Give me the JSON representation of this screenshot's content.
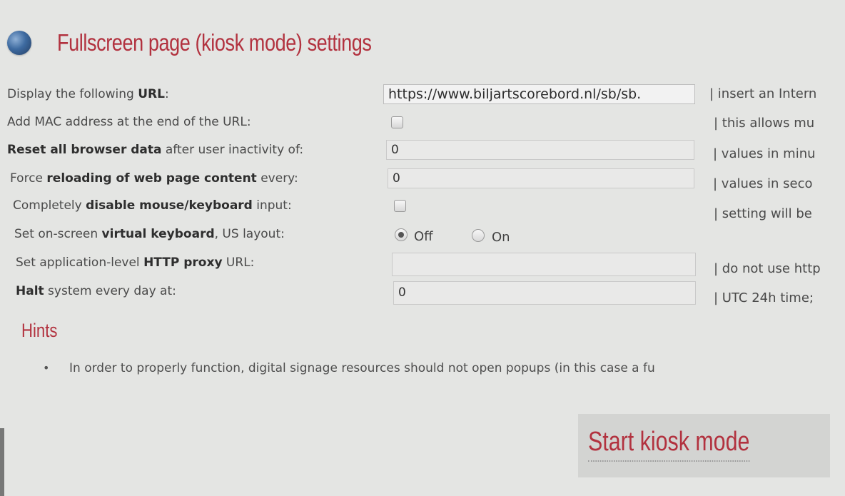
{
  "header": {
    "title": "Fullscreen page (kiosk mode) settings",
    "icon": "globe-icon"
  },
  "settings": {
    "url": {
      "label_pre": "Display the following ",
      "label_bold": "URL",
      "label_post": ":",
      "value": "https://www.biljartscorebord.nl/sb/sb.",
      "hint": "|  insert an Intern"
    },
    "mac": {
      "label": "Add MAC address at the end of the URL:",
      "checked": false,
      "hint": "|  this allows mu"
    },
    "reset": {
      "label_bold": "Reset all browser data",
      "label_post": " after user inactivity of:",
      "value": "0",
      "hint": "|  values in minu"
    },
    "reload": {
      "label_pre": "Force ",
      "label_bold": "reloading of web page content",
      "label_post": " every:",
      "value": "0",
      "hint": "|  values in seco"
    },
    "disable_input": {
      "label_pre": "Completely ",
      "label_bold": "disable mouse/keyboard",
      "label_post": " input:",
      "checked": false,
      "hint": "|  setting will be"
    },
    "virtual_keyboard": {
      "label_pre": "Set on-screen ",
      "label_bold": "virtual keyboard",
      "label_post": ", US layout:",
      "off_label": "Off",
      "on_label": "On",
      "selected": "Off"
    },
    "proxy": {
      "label_pre": "Set application-level ",
      "label_bold": "HTTP proxy",
      "label_post": " URL:",
      "value": "",
      "hint": "|  do not use http"
    },
    "halt": {
      "label_bold": "Halt",
      "label_post": " system every day at:",
      "value": "0",
      "hint": "|  UTC 24h time;"
    }
  },
  "hints": {
    "heading": "Hints",
    "items": [
      "In order to properly function, digital signage resources should not open popups (in this case a fu"
    ]
  },
  "actions": {
    "start_label": "Start kiosk mode"
  },
  "colors": {
    "accent": "#b2323f",
    "background": "#e4e5e3"
  }
}
